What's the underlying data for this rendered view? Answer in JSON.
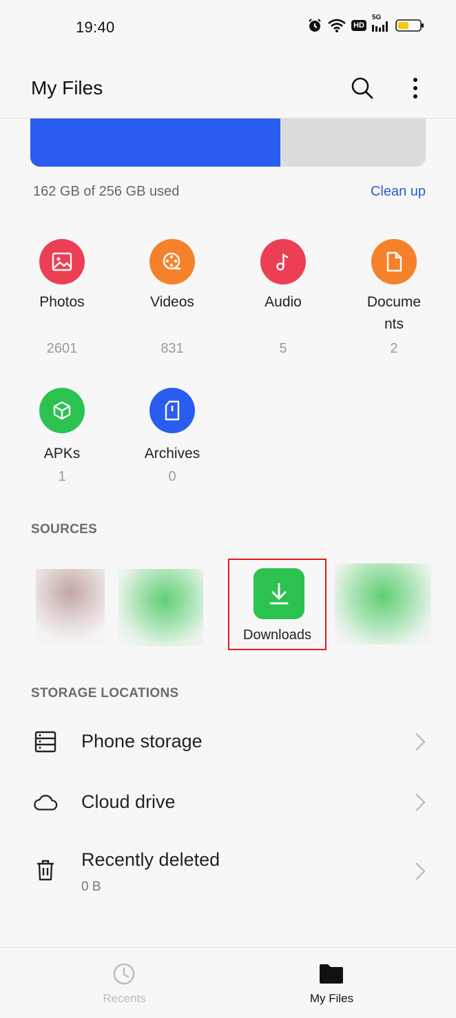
{
  "status_bar": {
    "time": "19:40",
    "network_label": "5G",
    "hd_label": "HD"
  },
  "header": {
    "title": "My Files"
  },
  "storage": {
    "used_fraction": 0.633,
    "summary": "162 GB of 256 GB used",
    "cleanup_label": "Clean up",
    "fill_color": "#2a5cf0"
  },
  "categories": [
    {
      "label": "Photos",
      "count": "2601",
      "icon": "image-icon",
      "color": "#ec3f55"
    },
    {
      "label": "Videos",
      "count": "831",
      "icon": "film-reel-icon",
      "color": "#f5822a"
    },
    {
      "label": "Audio",
      "count": "5",
      "icon": "music-note-icon",
      "color": "#ec3f55"
    },
    {
      "label": "Docume\nnts",
      "count": "2",
      "icon": "document-icon",
      "color": "#f5822a"
    },
    {
      "label": "APKs",
      "count": "1",
      "icon": "cube-icon",
      "color": "#2bc24f"
    },
    {
      "label": "Archives",
      "count": "0",
      "icon": "archive-icon",
      "color": "#2a5cf0"
    }
  ],
  "sources": {
    "heading": "SOURCES",
    "downloads_label": "Downloads",
    "downloads_color": "#2bc24f"
  },
  "storage_locations": {
    "heading": "STORAGE LOCATIONS",
    "items": [
      {
        "label": "Phone storage",
        "icon": "server-icon"
      },
      {
        "label": "Cloud drive",
        "icon": "cloud-icon"
      },
      {
        "label": "Recently deleted",
        "sublabel": "0 B",
        "icon": "trash-icon"
      }
    ]
  },
  "bottom_nav": {
    "tabs": [
      {
        "label": "Recents",
        "icon": "clock-icon",
        "active": false
      },
      {
        "label": "My Files",
        "icon": "folder-icon",
        "active": true
      }
    ]
  }
}
